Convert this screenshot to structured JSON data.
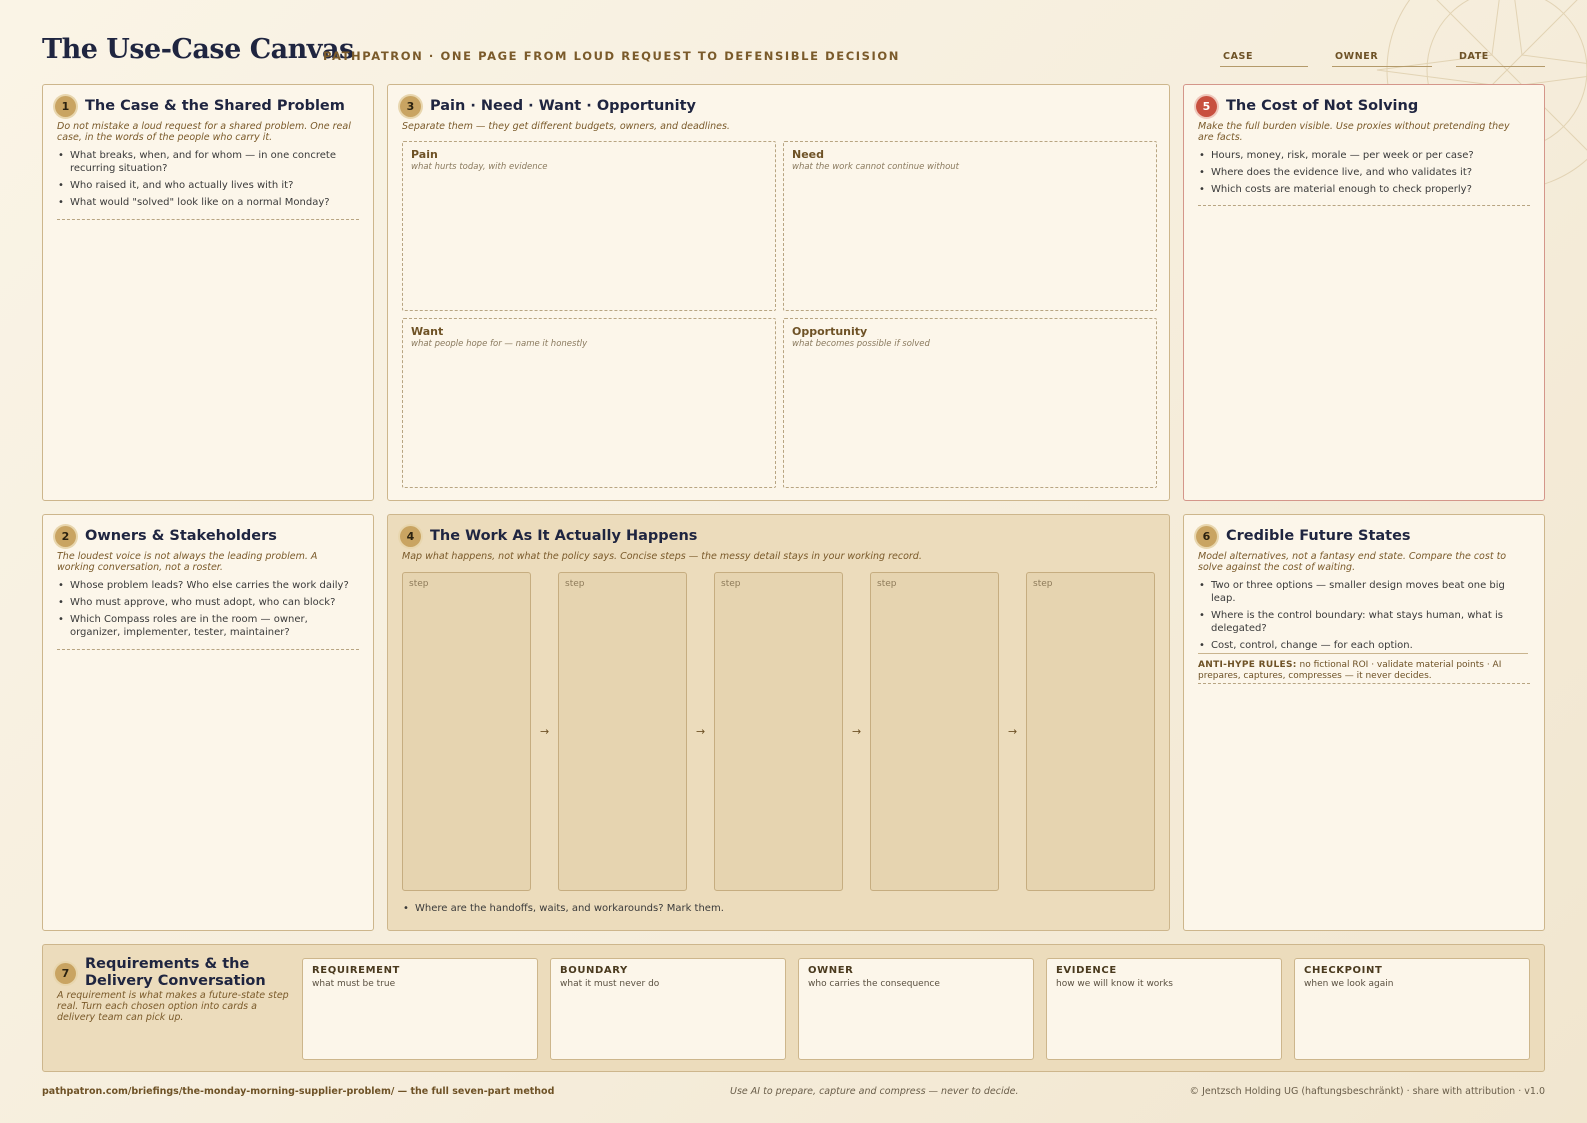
{
  "header": {
    "title": "The Use-Case Canvas",
    "subtitle": "PATHPATRON · ONE PAGE FROM LOUD REQUEST TO DEFENSIBLE DECISION",
    "fields": {
      "case": "CASE",
      "owner": "OWNER",
      "date": "DATE"
    }
  },
  "s1": {
    "num": "1",
    "title": "The Case & the Shared Problem",
    "intro": "Do not mistake a loud request for a shared problem. One real case, in the words of the people who carry it.",
    "bullets": [
      "What breaks, when, and for whom — in one concrete recurring situation?",
      "Who raised it, and who actually lives with it?",
      "What would \"solved\" look like on a normal Monday?"
    ]
  },
  "s2": {
    "num": "2",
    "title": "Owners & Stakeholders",
    "intro": "The loudest voice is not always the leading problem. A working conversation, not a roster.",
    "bullets": [
      "Whose problem leads? Who else carries the work daily?",
      "Who must approve, who must adopt, who can block?",
      "Which Compass roles are in the room — owner, organizer, implementer, tester, maintainer?"
    ]
  },
  "s3": {
    "num": "3",
    "title": "Pain · Need · Want · Opportunity",
    "intro": "Separate them — they get different budgets, owners, and deadlines.",
    "quads": [
      {
        "title": "Pain",
        "sub": "what hurts today, with evidence"
      },
      {
        "title": "Need",
        "sub": "what the work cannot continue without"
      },
      {
        "title": "Want",
        "sub": "what people hope for — name it honestly"
      },
      {
        "title": "Opportunity",
        "sub": "what becomes possible if solved"
      }
    ]
  },
  "s4": {
    "num": "4",
    "title": "The Work As It Actually Happens",
    "intro": "Map what happens, not what the policy says. Concise steps — the messy detail stays in your working record.",
    "steps": [
      "step",
      "step",
      "step",
      "step",
      "step"
    ],
    "arrow": "→",
    "bullet": "Where are the handoffs, waits, and workarounds? Mark them."
  },
  "s5": {
    "num": "5",
    "title": "The Cost of Not Solving",
    "intro": "Make the full burden visible. Use proxies without pretending they are facts.",
    "bullets": [
      "Hours, money, risk, morale — per week or per case?",
      "Where does the evidence live, and who validates it?",
      "Which costs are material enough to check properly?"
    ]
  },
  "s6": {
    "num": "6",
    "title": "Credible Future States",
    "intro": "Model alternatives, not a fantasy end state. Compare the cost to solve against the cost of waiting.",
    "bullets": [
      "Two or three options — smaller design moves beat one big leap.",
      "Where is the control boundary: what stays human, what is delegated?",
      "Cost, control, change — for each option."
    ],
    "anti_label": "ANTI-HYPE RULES:",
    "anti_text": "no fictional ROI · validate material points · AI prepares, captures, compresses — it never decides."
  },
  "s7": {
    "num": "7",
    "title": "Requirements & the Delivery Conversation",
    "intro": "A requirement is what makes a future-state step real. Turn each chosen option into cards a delivery team can pick up.",
    "cards": [
      {
        "title": "REQUIREMENT",
        "sub": "what must be true"
      },
      {
        "title": "BOUNDARY",
        "sub": "what it must never do"
      },
      {
        "title": "OWNER",
        "sub": "who carries the consequence"
      },
      {
        "title": "EVIDENCE",
        "sub": "how we will know it works"
      },
      {
        "title": "CHECKPOINT",
        "sub": "when we look again"
      }
    ]
  },
  "footer": {
    "left": "pathpatron.com/briefings/the-monday-morning-supplier-problem/ — the full seven-part method",
    "center": "Use AI to prepare, capture and compress — never to decide.",
    "right": "© Jentzsch Holding UG (haftungsbeschränkt) · share with attribution · v1.0"
  },
  "colors": {
    "background": "#f6eedd",
    "panel": "#fcf6ea",
    "panel_tan": "#ecdcbc",
    "title_navy": "#1f2540",
    "accent_brown": "#7a5a2a",
    "badge_gold": "#c9a462",
    "badge_red": "#c8503f"
  }
}
